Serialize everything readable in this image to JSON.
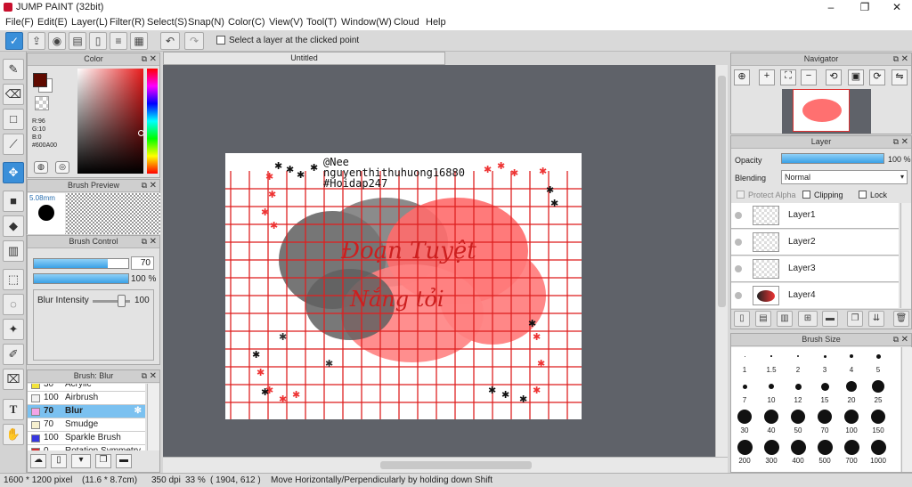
{
  "titlebar": {
    "title": "JUMP PAINT (32bit)",
    "minimize": "–",
    "restore": "❐",
    "close": "✕"
  },
  "menu": [
    "File(F)",
    "Edit(E)",
    "Layer(L)",
    "Filter(R)",
    "Select(S)",
    "Snap(N)",
    "Color(C)",
    "View(V)",
    "Tool(T)",
    "Window(W)",
    "Cloud",
    "Help"
  ],
  "toolbar": {
    "select_layer_checkbox_label": "Select a layer at the clicked point"
  },
  "color_panel": {
    "title": "Color",
    "r_label": "R:96",
    "g_label": "G:10",
    "b_label": "B:0",
    "hex_label": "#600A00",
    "main_color": "#600A00"
  },
  "brush_preview": {
    "title": "Brush Preview",
    "size_label": "5.08mm"
  },
  "brush_control": {
    "title": "Brush Control",
    "size_value": "70",
    "opacity_value": "100",
    "opacity_unit": "%",
    "blur_label": "Blur Intensity",
    "blur_value": "100",
    "size_fraction": 0.78,
    "opacity_fraction": 1.0,
    "blur_fraction": 1.0
  },
  "brush_list": {
    "title": "Brush: Blur",
    "items": [
      {
        "size": "30",
        "name": "Acrylic",
        "color": "#f2e33a"
      },
      {
        "size": "100",
        "name": "Airbrush",
        "color": "#f1f1f1"
      },
      {
        "size": "70",
        "name": "Blur",
        "color": "#f3a4e7",
        "selected": true
      },
      {
        "size": "70",
        "name": "Smudge",
        "color": "#f7f0cf"
      },
      {
        "size": "100",
        "name": "Sparkle Brush",
        "color": "#3838e0"
      },
      {
        "size": "0",
        "name": "Rotation Symmetry Pen",
        "color": "#d43030"
      }
    ]
  },
  "document": {
    "tab_label": "Untitled"
  },
  "canvas_text": {
    "line1": "@Nee",
    "line2": "nguyenthithuhuong16880",
    "line3": "#Hoidap247",
    "handwriting1": "Đoạn Tuyệt",
    "handwriting2": "Nắng tỏi"
  },
  "navigator": {
    "title": "Navigator"
  },
  "layer_panel": {
    "title": "Layer",
    "opacity_label": "Opacity",
    "opacity_value": "100 %",
    "opacity_fraction": 1.0,
    "blending_label": "Blending",
    "blending_value": "Normal",
    "protect_alpha_label": "Protect Alpha",
    "clipping_label": "Clipping",
    "lock_label": "Lock",
    "layers": [
      "Layer1",
      "Layer2",
      "Layer3",
      "Layer4"
    ]
  },
  "brush_size": {
    "title": "Brush Size",
    "sizes": [
      "1",
      "1.5",
      "2",
      "3",
      "4",
      "5",
      "7",
      "10",
      "12",
      "15",
      "20",
      "25",
      "30",
      "40",
      "50",
      "70",
      "100",
      "150",
      "200",
      "300",
      "400",
      "500",
      "700",
      "1000"
    ]
  },
  "status": {
    "dims": "1600 * 1200 pixel",
    "physical": "(11.6 * 8.7cm)",
    "dpi": "350 dpi",
    "zoom": "33 %",
    "coords": "( 1904, 612 )",
    "hint": "Move Horizontally/Perpendicularly by holding down Shift"
  }
}
